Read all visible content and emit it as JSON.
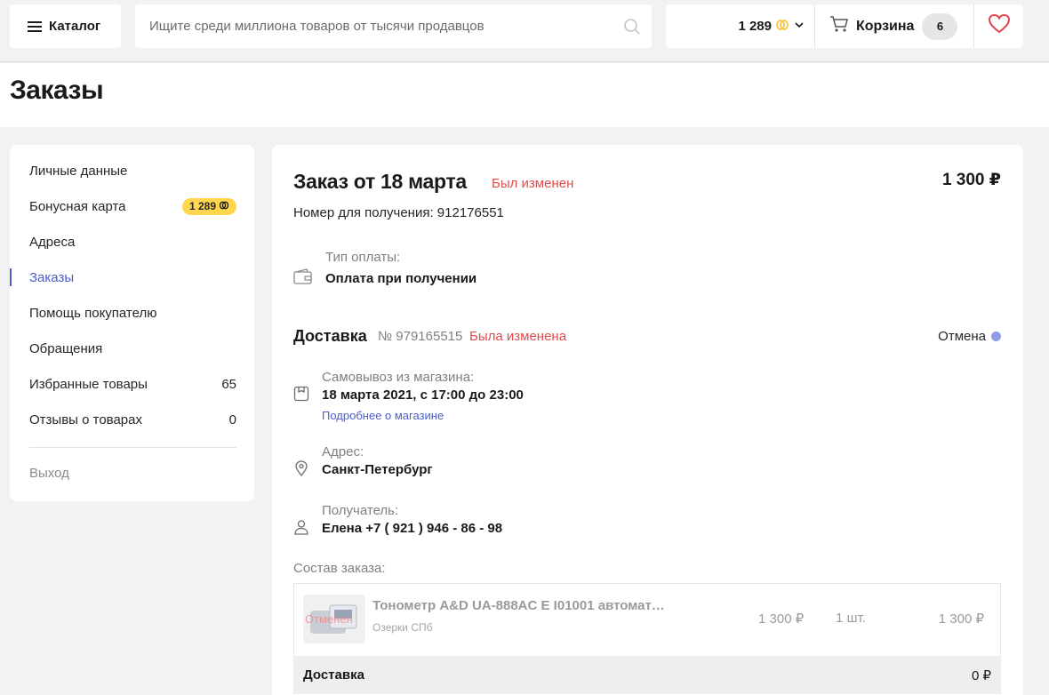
{
  "header": {
    "catalog_label": "Каталог",
    "search_placeholder": "Ищите среди миллиона товаров от тысячи продавцов",
    "bonus_amount": "1 289",
    "cart_label": "Корзина",
    "cart_count": "6"
  },
  "page": {
    "title": "Заказы"
  },
  "sidebar": {
    "items": [
      {
        "label": "Личные данные",
        "value": ""
      },
      {
        "label": "Бонусная карта",
        "value": "1 289"
      },
      {
        "label": "Адреса",
        "value": ""
      },
      {
        "label": "Заказы",
        "value": ""
      },
      {
        "label": "Помощь покупателю",
        "value": ""
      },
      {
        "label": "Обращения",
        "value": ""
      },
      {
        "label": "Избранные товары",
        "value": "65"
      },
      {
        "label": "Отзывы о товарах",
        "value": "0"
      }
    ],
    "exit_label": "Выход",
    "active_index": 3
  },
  "order": {
    "title": "Заказ от 18 марта",
    "status": "Был изменен",
    "total": "1 300 ₽",
    "number_label": "Номер для получения: 912176551",
    "payment_label": "Тип оплаты:",
    "payment_value": "Оплата при получении",
    "delivery": {
      "title": "Доставка",
      "number": "№ 979165515",
      "status": "Была изменена",
      "cancel_label": "Отмена",
      "pickup_label": "Самовывоз из магазина:",
      "pickup_value": "18 марта 2021, с 17:00 до 23:00",
      "store_link": "Подробнее о магазине",
      "address_label": "Адрес:",
      "address_value": "Санкт-Петербург",
      "recipient_label": "Получатель:",
      "recipient_value": "Елена +7 ( 921 ) 946 - 86 - 98"
    },
    "composition_label": "Состав заказа:",
    "items": [
      {
        "name": "Тонометр A&D UA-888AC E I01001 автомат…",
        "shop": "Озерки СПб",
        "thumb_tag": "Отменен",
        "price": "1 300 ₽",
        "qty": "1 шт.",
        "sum": "1 300 ₽"
      }
    ],
    "delivery_row": {
      "label": "Доставка",
      "value": "0 ₽"
    }
  },
  "colors": {
    "accent": "#4c5ec8",
    "alert": "#e24b4b",
    "bonus": "#ffd64d"
  }
}
